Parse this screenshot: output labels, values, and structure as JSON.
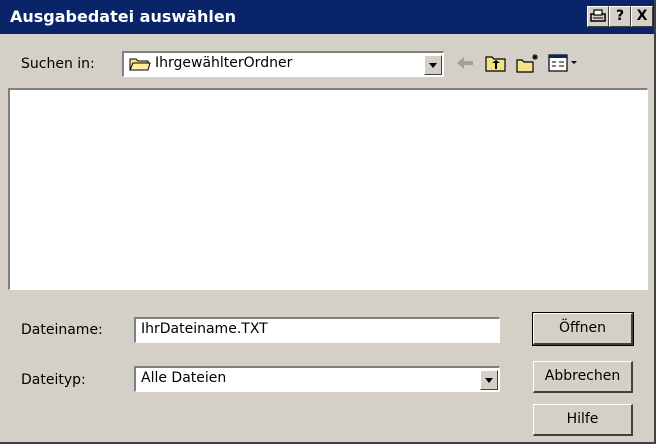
{
  "window": {
    "title": "Ausgabedatei auswählen",
    "title_buttons": [
      "?",
      "X"
    ]
  },
  "lookin": {
    "label": "Suchen in:",
    "value": "IhrgewählterOrdner"
  },
  "toolbar": {
    "icons": [
      "back-arrow-icon",
      "up-folder-icon",
      "new-folder-icon",
      "view-menu-icon"
    ]
  },
  "filename": {
    "label": "Dateiname:",
    "value": "IhrDateiname.TXT"
  },
  "filetype": {
    "label": "Dateityp:",
    "value": "Alle Dateien"
  },
  "buttons": {
    "open": "Öffnen",
    "cancel": "Abbrechen",
    "help": "Hilfe"
  },
  "colors": {
    "titlebar": "#0a246a",
    "face": "#d4d0c8"
  }
}
